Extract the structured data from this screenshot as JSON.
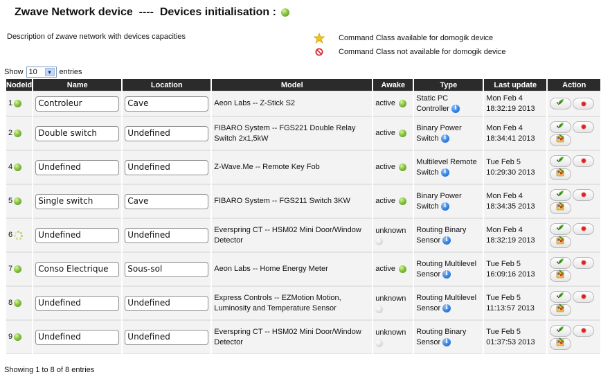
{
  "header": {
    "title": "Zwave Network device  ----  Devices initialisation :",
    "status_icon": "green-status-dot"
  },
  "description": "Description of zwave network with devices capacities",
  "legend": {
    "available": {
      "icon": "star-icon",
      "label": "Command Class available for domogik device",
      "color": "#f2c318"
    },
    "unavailable": {
      "icon": "prohibited-icon",
      "label": "Command Class not available for domogik device",
      "color": "#d9262b"
    }
  },
  "controls": {
    "show_label": "Show",
    "page_size": "10",
    "entries_label": "entries"
  },
  "table": {
    "columns": [
      "NodeId",
      "Name",
      "Location",
      "Model",
      "Awake",
      "Type",
      "Last update",
      "Action"
    ],
    "rows": [
      {
        "nodeid": "1",
        "status": "green",
        "name": "Controleur",
        "location": "Cave",
        "model": "Aeon Labs -- Z-Stick S2",
        "awake": "active",
        "awake_status": "green",
        "type": "Static PC Controller",
        "last_update_day": "Mon Feb 4",
        "last_update_time": "18:32:19 2013"
      },
      {
        "nodeid": "2",
        "status": "green",
        "name": "Double switch",
        "location": "Undefined",
        "model": "FIBARO System -- FGS221 Double Relay Switch 2x1,5kW",
        "awake": "active",
        "awake_status": "green",
        "type": "Binary Power Switch",
        "last_update_day": "Mon Feb 4",
        "last_update_time": "18:34:41 2013"
      },
      {
        "nodeid": "4",
        "status": "green",
        "name": "Undefined",
        "location": "Undefined",
        "model": "Z-Wave.Me -- Remote Key Fob",
        "awake": "active",
        "awake_status": "green",
        "type": "Multilevel Remote Switch",
        "last_update_day": "Tue Feb 5",
        "last_update_time": "10:29:30 2013"
      },
      {
        "nodeid": "5",
        "status": "green",
        "name": "Single switch",
        "location": "Cave",
        "model": "FIBARO System -- FGS211 Switch 3KW",
        "awake": "active",
        "awake_status": "green",
        "type": "Binary Power Switch",
        "last_update_day": "Mon Feb 4",
        "last_update_time": "18:34:35 2013"
      },
      {
        "nodeid": "6",
        "status": "loading",
        "name": "Undefined",
        "location": "Undefined",
        "model": "Everspring CT -- HSM02 Mini Door/Window Detector",
        "awake": "unknown",
        "awake_status": "grey",
        "type": "Routing Binary Sensor",
        "last_update_day": "Mon Feb 4",
        "last_update_time": "18:32:19 2013"
      },
      {
        "nodeid": "7",
        "status": "green",
        "name": "Conso Electrique",
        "location": "Sous-sol",
        "model": "Aeon Labs -- Home Energy Meter",
        "awake": "active",
        "awake_status": "green",
        "type": "Routing Multilevel Sensor",
        "last_update_day": "Tue Feb 5",
        "last_update_time": "16:09:16 2013"
      },
      {
        "nodeid": "8",
        "status": "green",
        "name": "Undefined",
        "location": "Undefined",
        "model": "Express Controls -- EZMotion Motion, Luminosity and Temperature Sensor",
        "awake": "unknown",
        "awake_status": "grey",
        "type": "Routing Multilevel Sensor",
        "last_update_day": "Tue Feb 5",
        "last_update_time": "11:13:57 2013"
      },
      {
        "nodeid": "9",
        "status": "green",
        "name": "Undefined",
        "location": "Undefined",
        "model": "Everspring CT -- HSM02 Mini Door/Window Detector",
        "awake": "unknown",
        "awake_status": "grey",
        "type": "Routing Binary Sensor",
        "last_update_day": "Tue Feb 5",
        "last_update_time": "01:37:53 2013"
      }
    ]
  },
  "footer": "Showing 1 to 8 of 8 entries"
}
